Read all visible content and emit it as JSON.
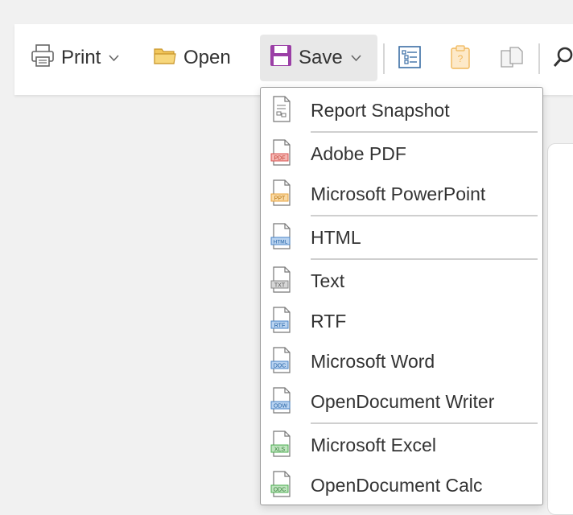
{
  "toolbar": {
    "print_label": "Print",
    "open_label": "Open",
    "save_label": "Save"
  },
  "save_menu": {
    "items": [
      {
        "label": "Report Snapshot",
        "badge": ""
      },
      {
        "label": "Adobe PDF",
        "badge": "PDF"
      },
      {
        "label": "Microsoft PowerPoint",
        "badge": "PPT"
      },
      {
        "label": "HTML",
        "badge": "HTML"
      },
      {
        "label": "Text",
        "badge": "TXT"
      },
      {
        "label": "RTF",
        "badge": "RTF"
      },
      {
        "label": "Microsoft Word",
        "badge": "DOC"
      },
      {
        "label": "OpenDocument Writer",
        "badge": "ODW"
      },
      {
        "label": "Microsoft Excel",
        "badge": "XLS"
      },
      {
        "label": "OpenDocument Calc",
        "badge": "ODC"
      }
    ]
  },
  "colors": {
    "save_purple": "#9b3fa6",
    "folder_yellow": "#f2c75c",
    "pdf_red": "#d9534f",
    "ppt_orange": "#e8a33d",
    "blue_badge": "#4a86c8",
    "green_badge": "#4caf50"
  }
}
